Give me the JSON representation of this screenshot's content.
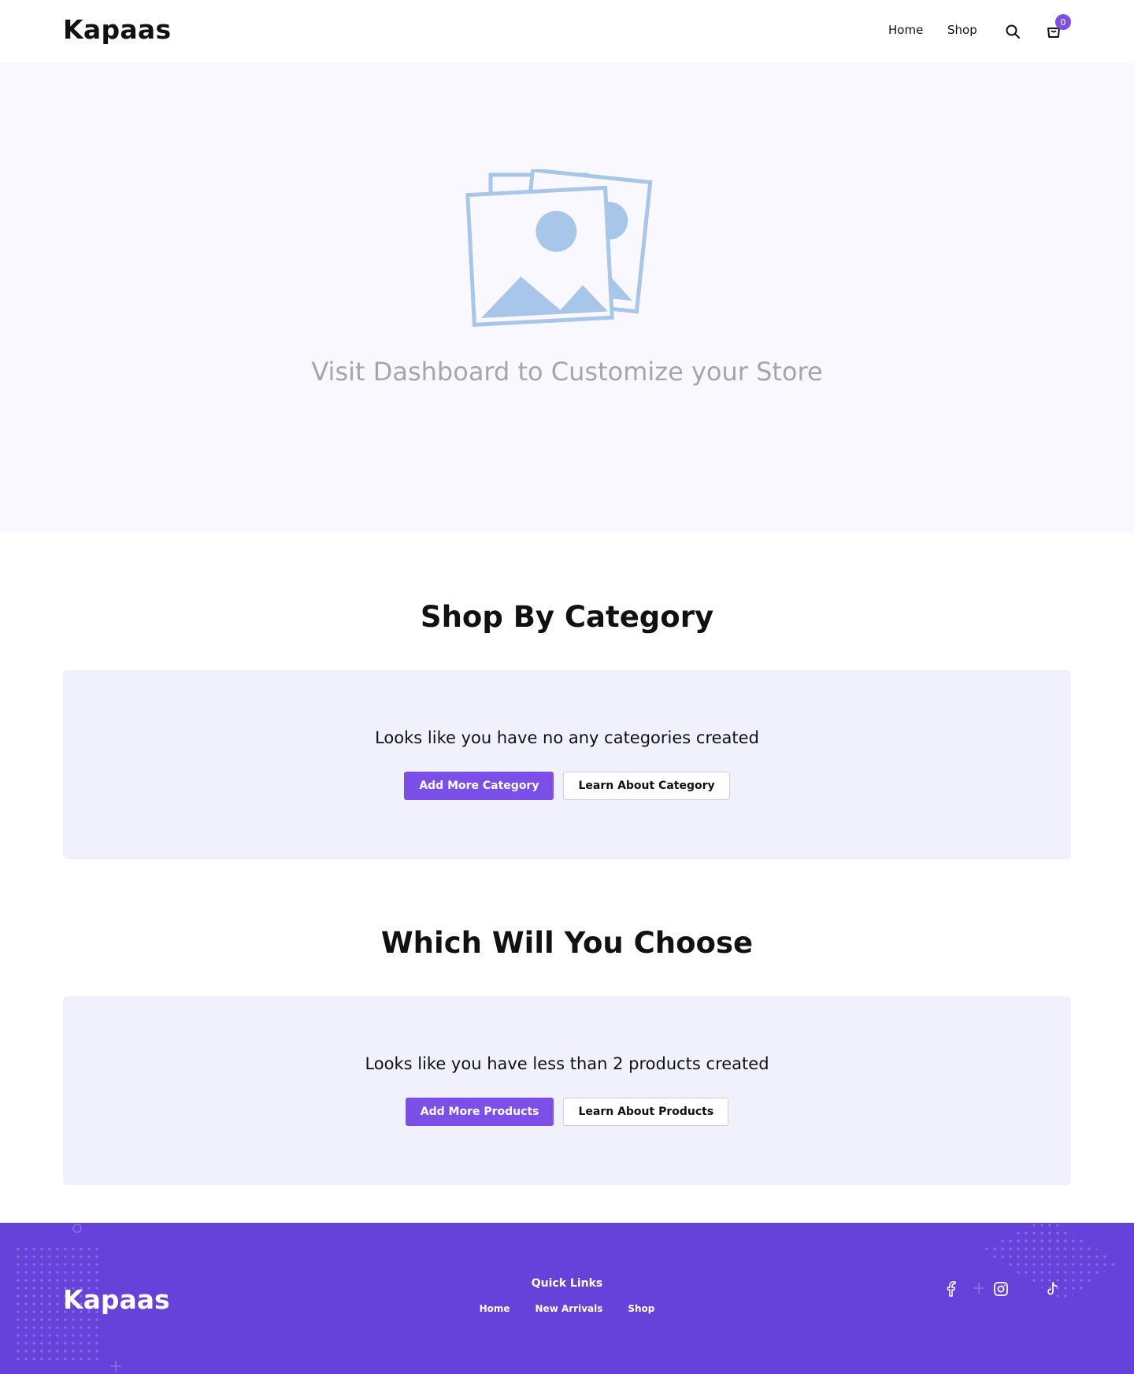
{
  "header": {
    "brand": "Kapaas",
    "nav": [
      {
        "label": "Home"
      },
      {
        "label": "Shop"
      }
    ],
    "search_icon": "search-icon",
    "cart_icon": "shopping-bag-icon",
    "cart_count": "0"
  },
  "hero": {
    "illustration": "image-placeholder-icon",
    "text": "Visit Dashboard to Customize your Store"
  },
  "categories": {
    "title": "Shop By Category",
    "message": "Looks like you have no any categories created",
    "primary_button": "Add More Category",
    "secondary_button": "Learn About Category"
  },
  "products": {
    "title": "Which Will You Choose",
    "message": "Looks like you have less than 2 products created",
    "primary_button": "Add More Products",
    "secondary_button": "Learn About Products"
  },
  "footer": {
    "brand": "Kapaas",
    "quick_links_title": "Quick Links",
    "quick_links": [
      {
        "label": "Home"
      },
      {
        "label": "New Arrivals"
      },
      {
        "label": "Shop"
      }
    ],
    "social": [
      "facebook-icon",
      "instagram-icon",
      "tiktok-icon"
    ]
  },
  "colors": {
    "accent": "#7b4fe8",
    "footer_bg": "#6642db",
    "hero_bg": "#f9f8fe",
    "panel_bg": "#f1f0fd",
    "illustration": "#a8c5ea"
  }
}
